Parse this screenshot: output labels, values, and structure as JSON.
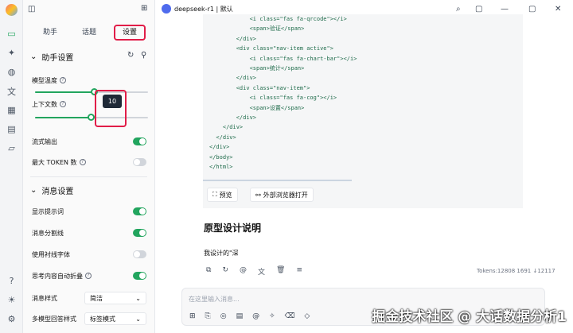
{
  "panel": {
    "tabs": [
      "助手",
      "话题",
      "设置"
    ],
    "assistant_section": "助手设置",
    "model_temp_label": "模型温度",
    "context_count_label": "上下文数",
    "temp_fraction": 0.53,
    "context_fraction": 0.5,
    "context_tooltip": "10",
    "rows": [
      {
        "label": "流式输出",
        "on": true,
        "help": false
      },
      {
        "label": "最大 TOKEN 数",
        "on": false,
        "help": true
      }
    ],
    "message_section": "消息设置",
    "msg_rows": [
      {
        "label": "显示提示词",
        "on": true
      },
      {
        "label": "消息分割线",
        "on": true
      },
      {
        "label": "使用衬线字体",
        "on": false
      },
      {
        "label": "思考内容自动折叠",
        "on": true,
        "help": true
      }
    ],
    "msg_style_label": "消息样式",
    "msg_style_value": "简洁",
    "multi_model_label": "多模型回答样式",
    "multi_model_value": "标签模式"
  },
  "main": {
    "model_name": "deepseek-r1 | 默认",
    "code_lines": [
      "            <i class=\"fas fa-qrcode\"></i>",
      "            <span>验证</span>",
      "        </div>",
      "        <div class=\"nav-item active\">",
      "            <i class=\"fas fa-chart-bar\"></i>",
      "            <span>统计</span>",
      "        </div>",
      "        <div class=\"nav-item\">",
      "            <i class=\"fas fa-cog\"></i>",
      "            <span>设置</span>",
      "        </div>",
      "    </div>",
      "  </div>",
      "</div>",
      "</body>",
      "</html>"
    ],
    "preview_label": "预览",
    "open_external_label": "外部浏览器打开",
    "heading": "原型设计说明",
    "paragraph": "我设计的\"深",
    "tokens": "Tokens:12808 1691 ↓12117",
    "input_placeholder": "在这里输入消息..."
  },
  "watermark": "掘金技术社区 @ 大话数据分析1"
}
